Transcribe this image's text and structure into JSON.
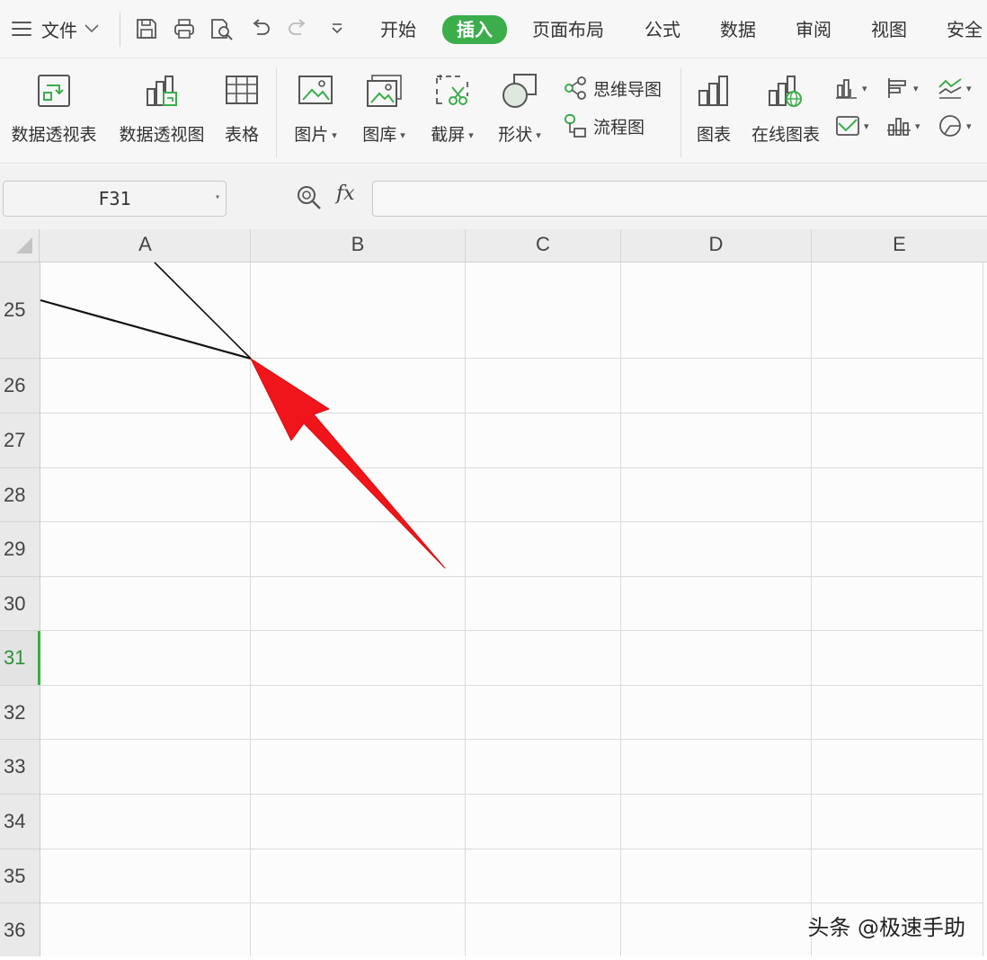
{
  "menu": {
    "file_label": "文件",
    "tabs": [
      {
        "label": "开始",
        "active": false
      },
      {
        "label": "插入",
        "active": true
      },
      {
        "label": "页面布局",
        "active": false
      },
      {
        "label": "公式",
        "active": false
      },
      {
        "label": "数据",
        "active": false
      },
      {
        "label": "审阅",
        "active": false
      },
      {
        "label": "视图",
        "active": false
      },
      {
        "label": "安全",
        "active": false
      }
    ],
    "accent_color": "#3bad4b"
  },
  "ribbon": {
    "pivot_table": "数据透视表",
    "pivot_chart": "数据透视图",
    "table": "表格",
    "picture": "图片",
    "gallery": "图库",
    "screenshot": "截屏",
    "shape": "形状",
    "mind_map": "思维导图",
    "flowchart": "流程图",
    "chart": "图表",
    "online_chart": "在线图表"
  },
  "formula_bar": {
    "name_box": "F31",
    "fx_label": "fx",
    "formula_value": ""
  },
  "grid": {
    "columns": [
      "A",
      "B",
      "C",
      "D",
      "E"
    ],
    "rows": [
      "25",
      "26",
      "27",
      "28",
      "29",
      "30",
      "31",
      "32",
      "33",
      "34",
      "35",
      "36"
    ],
    "active_row": "31",
    "annotation_arrow_color": "#f0151a"
  },
  "watermark": "头条 @极速手助"
}
